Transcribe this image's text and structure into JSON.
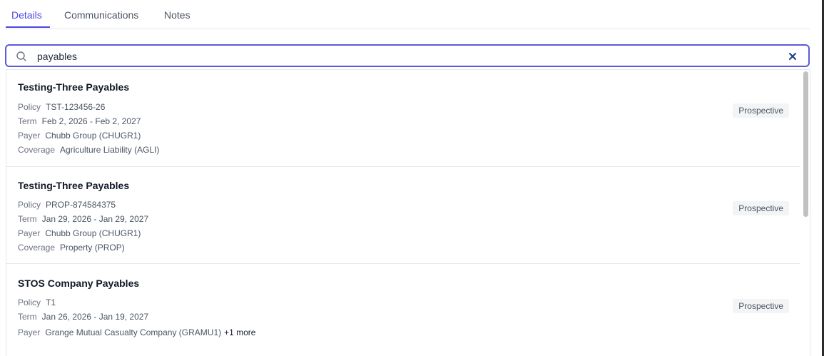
{
  "tabs": [
    {
      "label": "Details"
    },
    {
      "label": "Communications"
    },
    {
      "label": "Notes"
    }
  ],
  "search": {
    "value": "payables",
    "placeholder": ""
  },
  "labels": {
    "policy": "Policy",
    "term": "Term",
    "payer": "Payer",
    "coverage": "Coverage"
  },
  "results": [
    {
      "title": "Testing-Three Payables",
      "policy": "TST-123456-26",
      "term": "Feb 2, 2026 - Feb 2, 2027",
      "payer": "Chubb Group (CHUGR1)",
      "coverage": "Agriculture Liability (AGLI)",
      "status": "Prospective"
    },
    {
      "title": "Testing-Three Payables",
      "policy": "PROP-874584375",
      "term": "Jan 29, 2026 - Jan 29, 2027",
      "payer": "Chubb Group (CHUGR1)",
      "coverage": "Property (PROP)",
      "status": "Prospective"
    },
    {
      "title": "STOS Company Payables",
      "policy": "T1",
      "term": "Jan 26, 2026 - Jan 19, 2027",
      "payer": "Grange Mutual Casualty Company (GRAMU1)",
      "payer_more": "+1 more",
      "status": "Prospective"
    }
  ],
  "colors": {
    "accent": "#4f46e5",
    "badge_bg": "#f3f4f6"
  }
}
